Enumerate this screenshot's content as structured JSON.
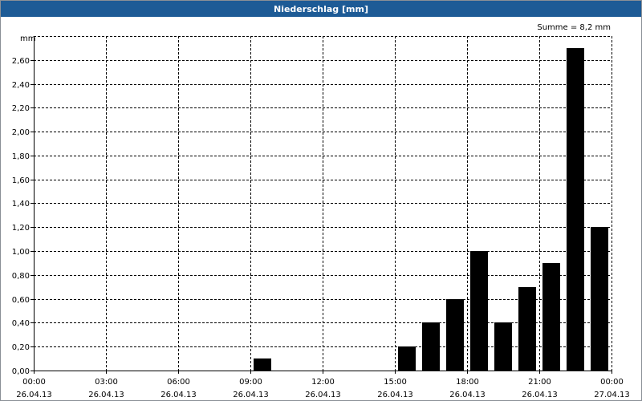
{
  "window": {
    "title": "Niederschlag [mm]"
  },
  "chart_data": {
    "type": "bar",
    "title": "Niederschlag [mm]",
    "unit_label": "mm",
    "annotation": "Summe = 8,2 mm",
    "ylim": [
      0,
      2.8
    ],
    "y_ticks": [
      "0,00",
      "0,20",
      "0,40",
      "0,60",
      "0,80",
      "1,00",
      "1,20",
      "1,40",
      "1,60",
      "1,80",
      "2,00",
      "2,20",
      "2,40",
      "2,60"
    ],
    "x_range_hours": [
      0,
      24
    ],
    "x_ticks": [
      {
        "time": "00:00",
        "date": "26.04.13"
      },
      {
        "time": "03:00",
        "date": "26.04.13"
      },
      {
        "time": "06:00",
        "date": "26.04.13"
      },
      {
        "time": "09:00",
        "date": "26.04.13"
      },
      {
        "time": "12:00",
        "date": "26.04.13"
      },
      {
        "time": "15:00",
        "date": "26.04.13"
      },
      {
        "time": "18:00",
        "date": "26.04.13"
      },
      {
        "time": "21:00",
        "date": "26.04.13"
      },
      {
        "time": "00:00",
        "date": "27.04.13"
      }
    ],
    "categories": [
      "00:00",
      "01:00",
      "02:00",
      "03:00",
      "04:00",
      "05:00",
      "06:00",
      "07:00",
      "08:00",
      "09:00",
      "10:00",
      "11:00",
      "12:00",
      "13:00",
      "14:00",
      "15:00",
      "16:00",
      "17:00",
      "18:00",
      "19:00",
      "20:00",
      "21:00",
      "22:00",
      "23:00"
    ],
    "values": [
      0,
      0,
      0,
      0,
      0,
      0,
      0,
      0,
      0,
      0.1,
      0,
      0,
      0,
      0,
      0,
      0.2,
      0.4,
      0.6,
      1.0,
      0.4,
      0.7,
      0.9,
      2.7,
      1.2
    ],
    "grid": true,
    "colors": {
      "bar": "#000000",
      "grid": "#000000",
      "title_bar": "#1d5b96"
    }
  }
}
